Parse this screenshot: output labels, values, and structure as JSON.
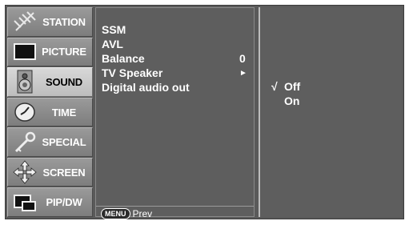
{
  "sidebar": {
    "items": [
      {
        "label": "STATION",
        "icon": "antenna-icon",
        "active": false
      },
      {
        "label": "PICTURE",
        "icon": "tv-screen-icon",
        "active": false
      },
      {
        "label": "SOUND",
        "icon": "speaker-icon",
        "active": true
      },
      {
        "label": "TIME",
        "icon": "clock-icon",
        "active": false
      },
      {
        "label": "SPECIAL",
        "icon": "key-icon",
        "active": false
      },
      {
        "label": "SCREEN",
        "icon": "move-arrows-icon",
        "active": false
      },
      {
        "label": "PIP/DW",
        "icon": "pip-window-icon",
        "active": false
      }
    ]
  },
  "menu": {
    "items": [
      {
        "label": "SSM",
        "value": "",
        "arrow": ""
      },
      {
        "label": "AVL",
        "value": "",
        "arrow": ""
      },
      {
        "label": "Balance",
        "value": "0",
        "arrow": ""
      },
      {
        "label": "TV Speaker",
        "value": "",
        "arrow": "►"
      },
      {
        "label": "Digital audio out",
        "value": "",
        "arrow": ""
      }
    ],
    "selected_index": 3
  },
  "footer": {
    "key_label": "MENU",
    "action_label": "Prev"
  },
  "submenu": {
    "options": [
      {
        "check": "√",
        "label": "Off"
      },
      {
        "check": "",
        "label": "On"
      }
    ]
  },
  "colors": {
    "panel_bg": "#5e5e5e",
    "active_tab_bg": "#cfcfcf",
    "text": "#ffffff"
  }
}
